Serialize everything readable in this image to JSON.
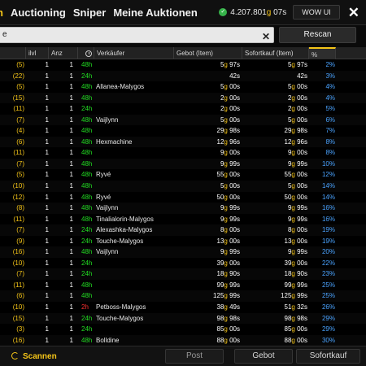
{
  "topbar": {
    "tabs": [
      "n",
      "Auctioning",
      "Sniper",
      "Meine Auktionen"
    ],
    "gold": "4.207.801",
    "gold_unit": "g",
    "gold_seconds": "07s",
    "wowui_label": "WOW UI",
    "close_label": "✕"
  },
  "search": {
    "value": "e",
    "clear_label": "✕",
    "rescan_label": "Rescan"
  },
  "table": {
    "headers": {
      "ilvl": "ilvl",
      "anz": "Anz",
      "seller": "Verkäufer",
      "bid": "Gebot (Item)",
      "buyout": "Sofortkauf (Item)",
      "pct": "%"
    },
    "rows": [
      {
        "stack": "(5)",
        "ilvl": "1",
        "anz": "1",
        "time": "48h",
        "seller": "",
        "bid_g": "5",
        "bid_s": "97s",
        "buy_g": "5",
        "buy_s": "97s",
        "pct": "2%"
      },
      {
        "stack": "(22)",
        "ilvl": "1",
        "anz": "1",
        "time": "24h",
        "seller": "",
        "bid_g": "",
        "bid_s": "42s",
        "buy_g": "",
        "buy_s": "42s",
        "pct": "3%"
      },
      {
        "stack": "(5)",
        "ilvl": "1",
        "anz": "1",
        "time": "48h",
        "seller": "Allanea-Malygos",
        "bid_g": "5",
        "bid_s": "00s",
        "buy_g": "5",
        "buy_s": "00s",
        "pct": "4%"
      },
      {
        "stack": "(15)",
        "ilvl": "1",
        "anz": "1",
        "time": "48h",
        "seller": "",
        "bid_g": "2",
        "bid_s": "00s",
        "buy_g": "2",
        "buy_s": "00s",
        "pct": "4%"
      },
      {
        "stack": "(11)",
        "ilvl": "1",
        "anz": "1",
        "time": "24h",
        "seller": "",
        "bid_g": "2",
        "bid_s": "00s",
        "buy_g": "2",
        "buy_s": "00s",
        "pct": "5%"
      },
      {
        "stack": "(7)",
        "ilvl": "1",
        "anz": "1",
        "time": "48h",
        "seller": "Vaijlynn",
        "bid_g": "5",
        "bid_s": "00s",
        "buy_g": "5",
        "buy_s": "00s",
        "pct": "6%"
      },
      {
        "stack": "(4)",
        "ilvl": "1",
        "anz": "1",
        "time": "48h",
        "seller": "",
        "bid_g": "29",
        "bid_s": "98s",
        "buy_g": "29",
        "buy_s": "98s",
        "pct": "7%"
      },
      {
        "stack": "(6)",
        "ilvl": "1",
        "anz": "1",
        "time": "48h",
        "seller": "Hexmachine",
        "bid_g": "12",
        "bid_s": "96s",
        "buy_g": "12",
        "buy_s": "96s",
        "pct": "8%"
      },
      {
        "stack": "(11)",
        "ilvl": "1",
        "anz": "1",
        "time": "48h",
        "seller": "",
        "bid_g": "9",
        "bid_s": "00s",
        "buy_g": "9",
        "buy_s": "00s",
        "pct": "8%"
      },
      {
        "stack": "(7)",
        "ilvl": "1",
        "anz": "1",
        "time": "48h",
        "seller": "",
        "bid_g": "9",
        "bid_s": "99s",
        "buy_g": "9",
        "buy_s": "99s",
        "pct": "10%"
      },
      {
        "stack": "(5)",
        "ilvl": "1",
        "anz": "1",
        "time": "48h",
        "seller": "Ryvé",
        "bid_g": "55",
        "bid_s": "00s",
        "buy_g": "55",
        "buy_s": "00s",
        "pct": "12%"
      },
      {
        "stack": "(10)",
        "ilvl": "1",
        "anz": "1",
        "time": "48h",
        "seller": "",
        "bid_g": "5",
        "bid_s": "00s",
        "buy_g": "5",
        "buy_s": "00s",
        "pct": "14%"
      },
      {
        "stack": "(12)",
        "ilvl": "1",
        "anz": "1",
        "time": "48h",
        "seller": "Ryvé",
        "bid_g": "50",
        "bid_s": "00s",
        "buy_g": "50",
        "buy_s": "00s",
        "pct": "14%"
      },
      {
        "stack": "(8)",
        "ilvl": "1",
        "anz": "1",
        "time": "48h",
        "seller": "Vaijlynn",
        "bid_g": "9",
        "bid_s": "99s",
        "buy_g": "9",
        "buy_s": "99s",
        "pct": "16%"
      },
      {
        "stack": "(11)",
        "ilvl": "1",
        "anz": "1",
        "time": "48h",
        "seller": "Tinalialorin-Malygos",
        "bid_g": "9",
        "bid_s": "99s",
        "buy_g": "9",
        "buy_s": "99s",
        "pct": "16%"
      },
      {
        "stack": "(7)",
        "ilvl": "1",
        "anz": "1",
        "time": "24h",
        "seller": "Alexashka-Malygos",
        "bid_g": "8",
        "bid_s": "00s",
        "buy_g": "8",
        "buy_s": "00s",
        "pct": "19%"
      },
      {
        "stack": "(9)",
        "ilvl": "1",
        "anz": "1",
        "time": "24h",
        "seller": "Touche-Malygos",
        "bid_g": "13",
        "bid_s": "00s",
        "buy_g": "13",
        "buy_s": "00s",
        "pct": "19%"
      },
      {
        "stack": "(16)",
        "ilvl": "1",
        "anz": "1",
        "time": "48h",
        "seller": "Vaijlynn",
        "bid_g": "9",
        "bid_s": "99s",
        "buy_g": "9",
        "buy_s": "99s",
        "pct": "20%"
      },
      {
        "stack": "(10)",
        "ilvl": "1",
        "anz": "1",
        "time": "24h",
        "seller": "",
        "bid_g": "39",
        "bid_s": "00s",
        "buy_g": "39",
        "buy_s": "00s",
        "pct": "22%"
      },
      {
        "stack": "(7)",
        "ilvl": "1",
        "anz": "1",
        "time": "24h",
        "seller": "",
        "bid_g": "18",
        "bid_s": "90s",
        "buy_g": "18",
        "buy_s": "90s",
        "pct": "23%"
      },
      {
        "stack": "(11)",
        "ilvl": "1",
        "anz": "1",
        "time": "48h",
        "seller": "",
        "bid_g": "99",
        "bid_s": "99s",
        "buy_g": "99",
        "buy_s": "99s",
        "pct": "25%"
      },
      {
        "stack": "(6)",
        "ilvl": "1",
        "anz": "1",
        "time": "48h",
        "seller": "",
        "bid_g": "125",
        "bid_s": "99s",
        "buy_g": "125",
        "buy_s": "99s",
        "pct": "25%"
      },
      {
        "stack": "(10)",
        "ilvl": "1",
        "anz": "1",
        "time": "2h",
        "seller": "Petboss-Malygos",
        "bid_g": "38",
        "bid_s": "49s",
        "buy_g": "51",
        "buy_s": "32s",
        "pct": "26%"
      },
      {
        "stack": "(15)",
        "ilvl": "1",
        "anz": "1",
        "time": "24h",
        "seller": "Touche-Malygos",
        "bid_g": "98",
        "bid_s": "98s",
        "buy_g": "98",
        "buy_s": "98s",
        "pct": "29%"
      },
      {
        "stack": "(3)",
        "ilvl": "1",
        "anz": "1",
        "time": "24h",
        "seller": "",
        "bid_g": "85",
        "bid_s": "00s",
        "buy_g": "85",
        "buy_s": "00s",
        "pct": "29%"
      },
      {
        "stack": "(16)",
        "ilvl": "1",
        "anz": "1",
        "time": "48h",
        "seller": "Bolldine",
        "bid_g": "88",
        "bid_s": "00s",
        "buy_g": "88",
        "buy_s": "00s",
        "pct": "30%"
      }
    ]
  },
  "bottom": {
    "scan_label": "Scannen",
    "post_label": "Post",
    "bid_label": "Gebot",
    "buyout_label": "Sofortkauf"
  }
}
